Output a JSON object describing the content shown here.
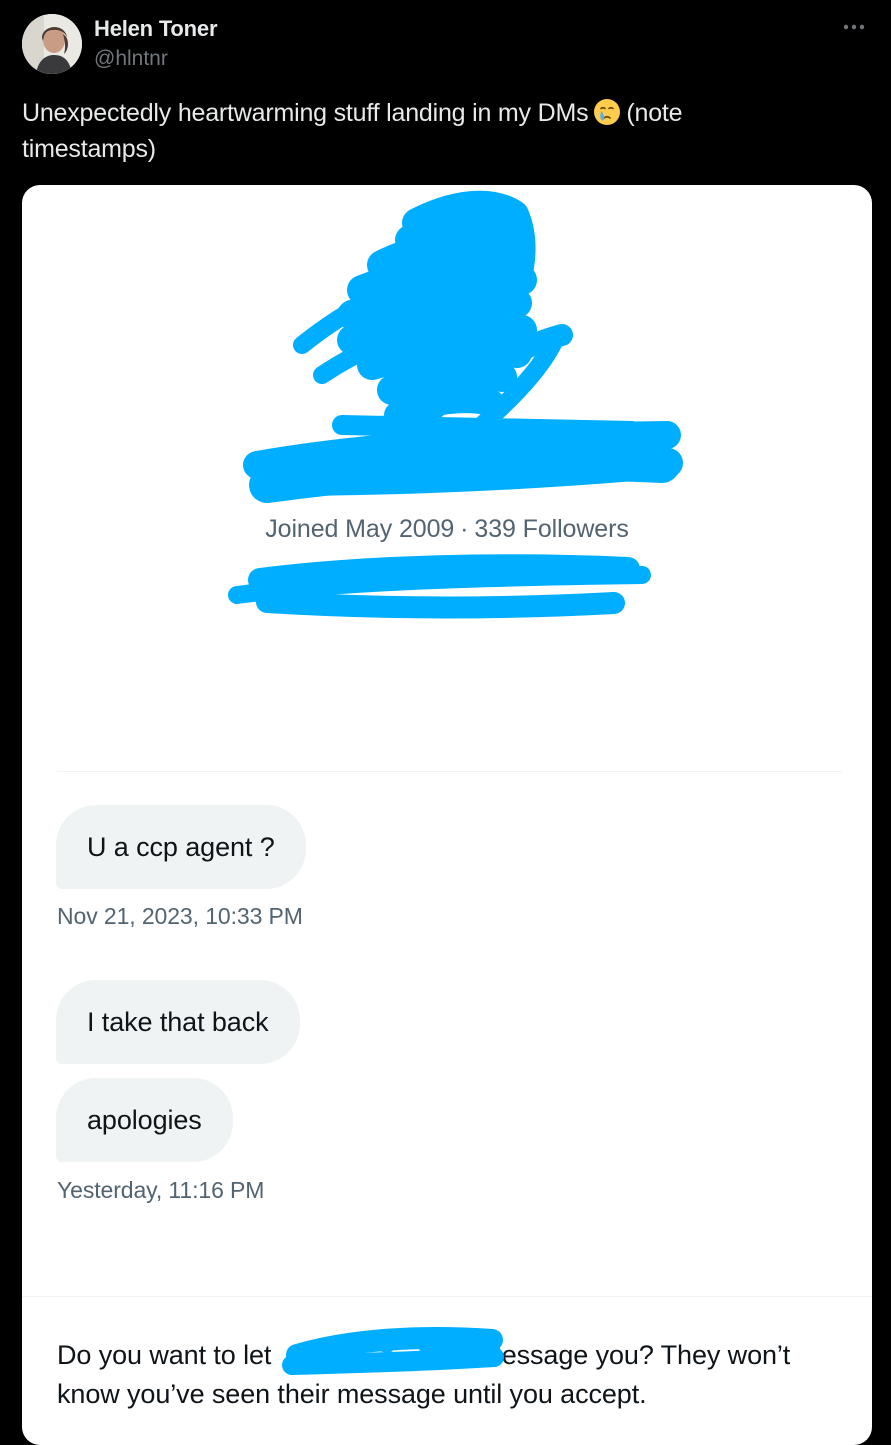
{
  "tweet": {
    "author_name": "Helen Toner",
    "author_handle": "@hlntnr",
    "text_before_emoji": "Unexpectedly heartwarming stuff landing in my DMs",
    "emoji": "face-holding-back-tears-icon",
    "text_after_emoji": "(note timestamps)"
  },
  "dm_screenshot": {
    "profile": {
      "joined": "Joined May 2009",
      "separator": "·",
      "followers": "339 Followers"
    },
    "messages": [
      {
        "text": "U a ccp agent ?"
      },
      {
        "text": "I take that back"
      },
      {
        "text": "apologies"
      }
    ],
    "timestamps": [
      "Nov 21, 2023, 10:33 PM",
      "Yesterday, 11:16 PM"
    ],
    "request": {
      "before_name": "Do you want to let",
      "after_name": "message you? They won’t know you’ve seen their message until you accept."
    }
  },
  "colors": {
    "background": "#000000",
    "text_primary": "#e7e9ea",
    "text_secondary": "#71767b",
    "card_background": "#ffffff",
    "bubble": "#eff3f4",
    "redaction": "#00aeff"
  }
}
